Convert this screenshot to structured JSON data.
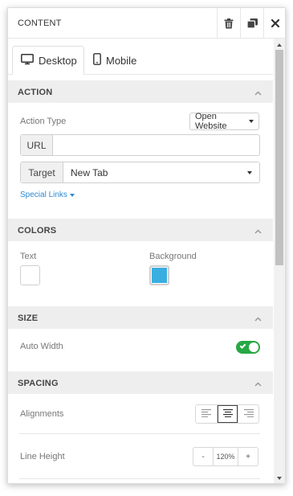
{
  "panel": {
    "title": "CONTENT",
    "icons": [
      "trash-icon",
      "duplicate-icon",
      "close-icon"
    ]
  },
  "tabs": [
    {
      "label": "Desktop",
      "icon": "desktop-icon",
      "active": true
    },
    {
      "label": "Mobile",
      "icon": "mobile-icon",
      "active": false
    }
  ],
  "action": {
    "heading": "ACTION",
    "action_type_label": "Action Type",
    "action_type_value": "Open Website",
    "url_label": "URL",
    "url_value": "",
    "target_label": "Target",
    "target_value": "New Tab",
    "special_links": "Special Links"
  },
  "colors": {
    "heading": "COLORS",
    "text_label": "Text",
    "text_color": "#ffffff",
    "background_label": "Background",
    "background_color": "#3aaee0"
  },
  "size": {
    "heading": "SIZE",
    "auto_width_label": "Auto Width",
    "auto_width_on": true
  },
  "spacing": {
    "heading": "SPACING",
    "alignments_label": "Alignments",
    "alignment_selected": "center",
    "line_height_label": "Line Height",
    "line_height_minus": "-",
    "line_height_value": "120%",
    "line_height_plus": "+"
  },
  "colors_theme": {
    "accent": "#27a844",
    "link": "#2d8ad3",
    "section_bg": "#eeeeee"
  }
}
